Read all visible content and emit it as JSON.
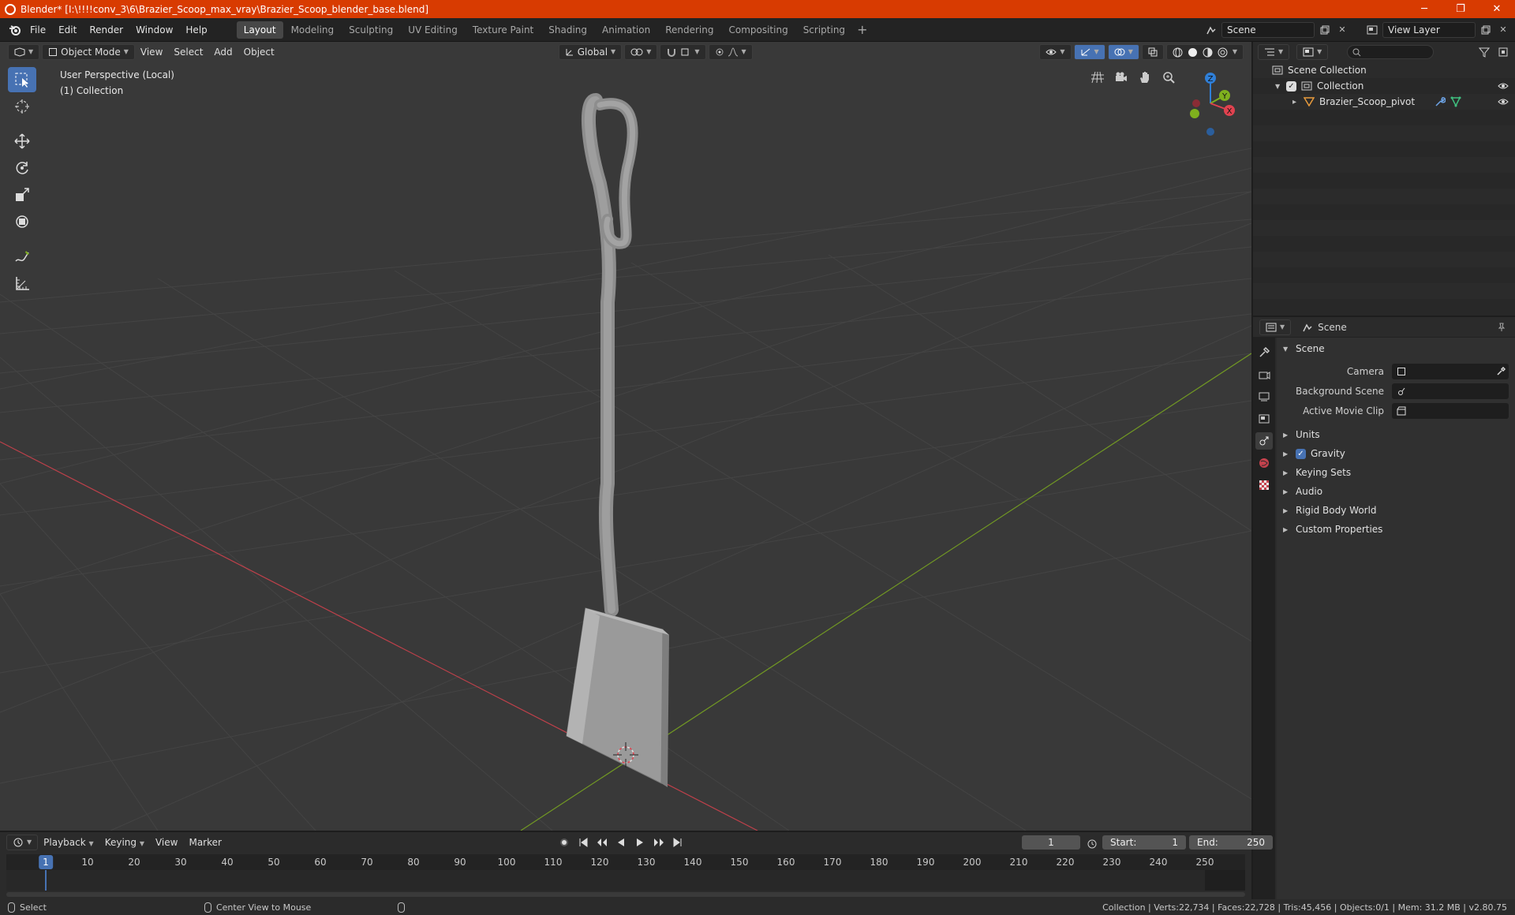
{
  "window": {
    "title": "Blender* [I:\\!!!!conv_3\\6\\Brazier_Scoop_max_vray\\Brazier_Scoop_blender_base.blend]",
    "minimize": "─",
    "maximize": "❐",
    "close": "✕"
  },
  "topbar": {
    "menus": [
      "File",
      "Edit",
      "Render",
      "Window",
      "Help"
    ],
    "workspaces": [
      "Layout",
      "Modeling",
      "Sculpting",
      "UV Editing",
      "Texture Paint",
      "Shading",
      "Animation",
      "Rendering",
      "Compositing",
      "Scripting"
    ],
    "active_workspace": "Layout",
    "add_workspace": "+",
    "scene": "Scene",
    "view_layer": "View Layer"
  },
  "viewport": {
    "mode": "Object Mode",
    "menus": [
      "View",
      "Select",
      "Add",
      "Object"
    ],
    "transform_orientation": "Global",
    "info_line1": "User Perspective (Local)",
    "info_line2": "(1) Collection",
    "axes": {
      "x": "X",
      "y": "Y",
      "z": "Z"
    }
  },
  "outliner": {
    "search_placeholder": "",
    "rows": {
      "scene_collection": "Scene Collection",
      "collection": "Collection",
      "object": "Brazier_Scoop_pivot"
    }
  },
  "properties": {
    "context": "Scene",
    "panel_title": "Scene",
    "fields": {
      "camera": "Camera",
      "background_scene": "Background Scene",
      "active_movie_clip": "Active Movie Clip"
    },
    "panels": [
      "Units",
      "Gravity",
      "Keying Sets",
      "Audio",
      "Rigid Body World",
      "Custom Properties"
    ]
  },
  "timeline": {
    "menus": [
      "Playback",
      "Keying",
      "View",
      "Marker"
    ],
    "current_frame": "1",
    "start_label": "Start:",
    "start_value": "1",
    "end_label": "End:",
    "end_value": "250",
    "ticks": [
      "10",
      "20",
      "30",
      "40",
      "50",
      "60",
      "70",
      "80",
      "90",
      "100",
      "110",
      "120",
      "130",
      "140",
      "150",
      "160",
      "170",
      "180",
      "190",
      "200",
      "210",
      "220",
      "230",
      "240",
      "250"
    ]
  },
  "statusbar": {
    "select": "Select",
    "center_view": "Center View to Mouse",
    "stats": "Collection | Verts:22,734 | Faces:22,728 | Tris:45,456 | Objects:0/1 | Mem: 31.2 MB | v2.80.75"
  },
  "colors": {
    "titlebar": "#d83b01",
    "accent": "#4772b3",
    "x_axis": "#e0424f",
    "y_axis": "#7fb01e",
    "z_axis": "#2f7fd8"
  }
}
